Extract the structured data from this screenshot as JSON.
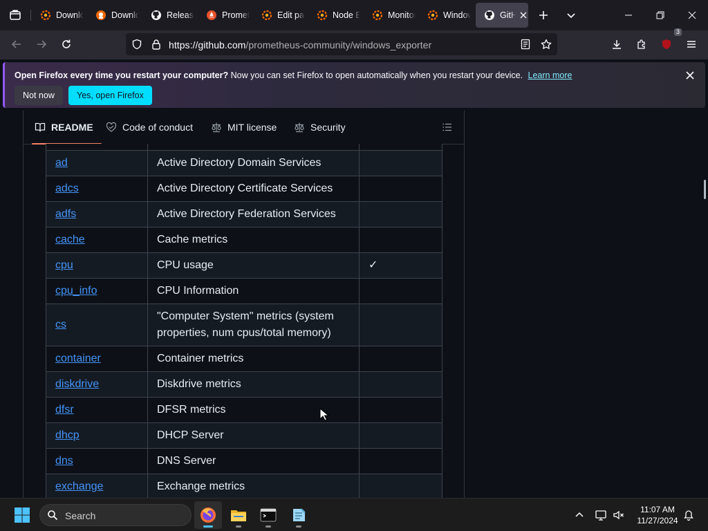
{
  "browser": {
    "tabs": [
      {
        "label": "Downloads | Grafana",
        "icon": "grafana-icon"
      },
      {
        "label": "Download Grafana",
        "icon": "grafana-labs-icon"
      },
      {
        "label": "Releases",
        "icon": "github-icon"
      },
      {
        "label": "Prometheus",
        "icon": "prometheus-icon"
      },
      {
        "label": "Edit panel",
        "icon": "grafana-icon"
      },
      {
        "label": "Node Exporter",
        "icon": "grafana-icon"
      },
      {
        "label": "Monitoring",
        "icon": "grafana-icon"
      },
      {
        "label": "Windows Exporter",
        "icon": "grafana-icon"
      },
      {
        "label": "GitHub",
        "icon": "github-icon",
        "active": true
      }
    ],
    "url": {
      "host": "https://github.com",
      "path": "/prometheus-community/windows_exporter"
    },
    "extension_badge": "3"
  },
  "notification": {
    "bold": "Open Firefox every time you restart your computer?",
    "text": "Now you can set Firefox to open automatically when you restart your device.",
    "link": "Learn more",
    "not_now": "Not now",
    "yes": "Yes, open Firefox"
  },
  "readme_tabs": [
    {
      "label": "README",
      "icon": "book-icon",
      "selected": true
    },
    {
      "label": "Code of conduct",
      "icon": "code-of-conduct-icon"
    },
    {
      "label": "MIT license",
      "icon": "law-icon"
    },
    {
      "label": "Security",
      "icon": "law-icon"
    }
  ],
  "collectors": [
    {
      "name": "ad",
      "description": "Active Directory Domain Services",
      "enabled": ""
    },
    {
      "name": "adcs",
      "description": "Active Directory Certificate Services",
      "enabled": ""
    },
    {
      "name": "adfs",
      "description": "Active Directory Federation Services",
      "enabled": ""
    },
    {
      "name": "cache",
      "description": "Cache metrics",
      "enabled": ""
    },
    {
      "name": "cpu",
      "description": "CPU usage",
      "enabled": "✓"
    },
    {
      "name": "cpu_info",
      "description": "CPU Information",
      "enabled": ""
    },
    {
      "name": "cs",
      "description": "\"Computer System\" metrics (system properties, num cpus/total memory)",
      "enabled": ""
    },
    {
      "name": "container",
      "description": "Container metrics",
      "enabled": ""
    },
    {
      "name": "diskdrive",
      "description": "Diskdrive metrics",
      "enabled": ""
    },
    {
      "name": "dfsr",
      "description": "DFSR metrics",
      "enabled": ""
    },
    {
      "name": "dhcp",
      "description": "DHCP Server",
      "enabled": ""
    },
    {
      "name": "dns",
      "description": "DNS Server",
      "enabled": ""
    },
    {
      "name": "exchange",
      "description": "Exchange metrics",
      "enabled": ""
    }
  ],
  "taskbar": {
    "search_label": "Search",
    "apps": [
      {
        "name": "firefox-icon",
        "running": true,
        "focused": true
      },
      {
        "name": "file-explorer-icon",
        "running": true
      },
      {
        "name": "terminal-icon",
        "running": true
      },
      {
        "name": "notepad-icon",
        "running": true
      }
    ],
    "time": "11:07 AM",
    "date": "11/27/2024"
  },
  "colors": {
    "link": "#4493f8",
    "accent": "#00ddff",
    "tab_underline": "#f78166"
  }
}
